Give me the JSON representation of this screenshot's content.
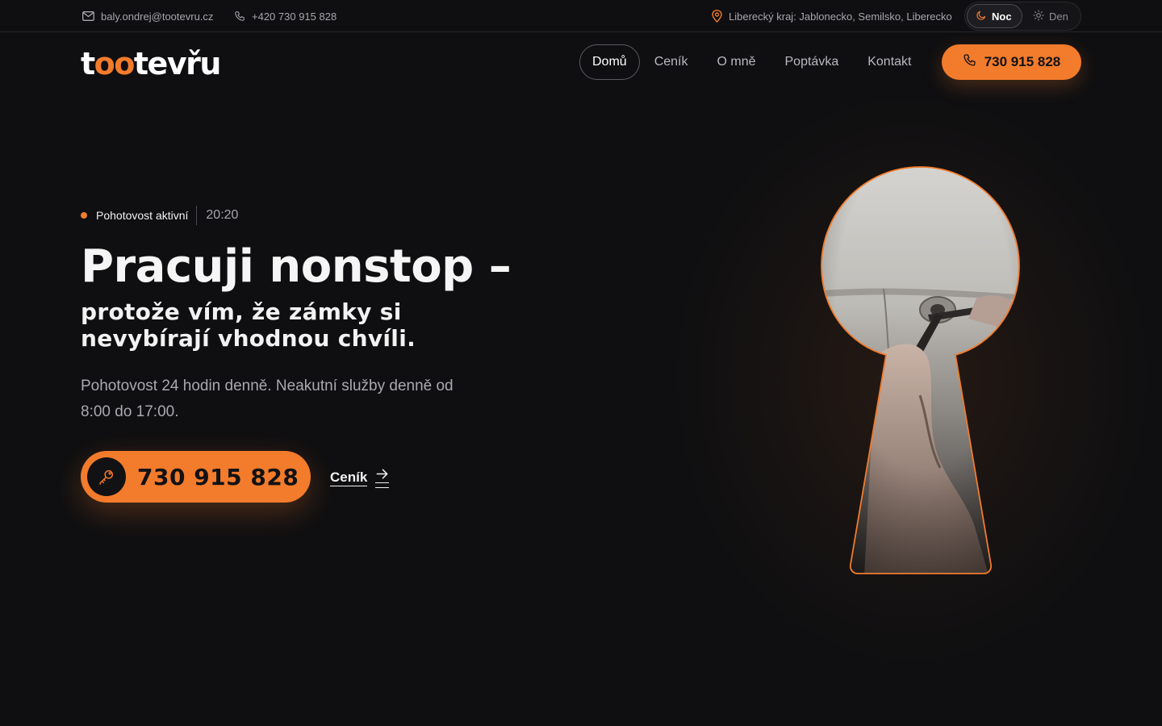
{
  "topbar": {
    "email": "baly.ondrej@tootevru.cz",
    "phone": "+420 730 915 828",
    "location": "Liberecký kraj: Jablonecko, Semilsko, Liberecko",
    "mode_night": "Noc",
    "mode_day": "Den",
    "active_mode": "Noc"
  },
  "header": {
    "logo_text": "tootevřu",
    "nav": [
      "Domů",
      "Ceník",
      "O mně",
      "Poptávka",
      "Kontakt"
    ],
    "active_nav": "Domů",
    "cta_phone": "730 915 828"
  },
  "hero": {
    "status_label": "Pohotovost aktivní",
    "status_time": "20:20",
    "title": "Pracuji nonstop –",
    "subtitle": "protože vím, že zámky si nevybírají vhodnou chvíli.",
    "lead": "Pohotovost 24 hodin denně. Neakutní služby denně od 8:00 do 17:00.",
    "cta_phone": "730 915 828",
    "secondary_link": "Ceník"
  },
  "colors": {
    "accent": "#f27b2c",
    "background": "#0f0f11",
    "text": "#f2f2f2",
    "muted": "#a6a6ad"
  },
  "icons": [
    "mail-icon",
    "phone-icon",
    "location-pin-icon",
    "moon-icon",
    "sun-icon",
    "key-icon",
    "arrow-right-icon"
  ]
}
